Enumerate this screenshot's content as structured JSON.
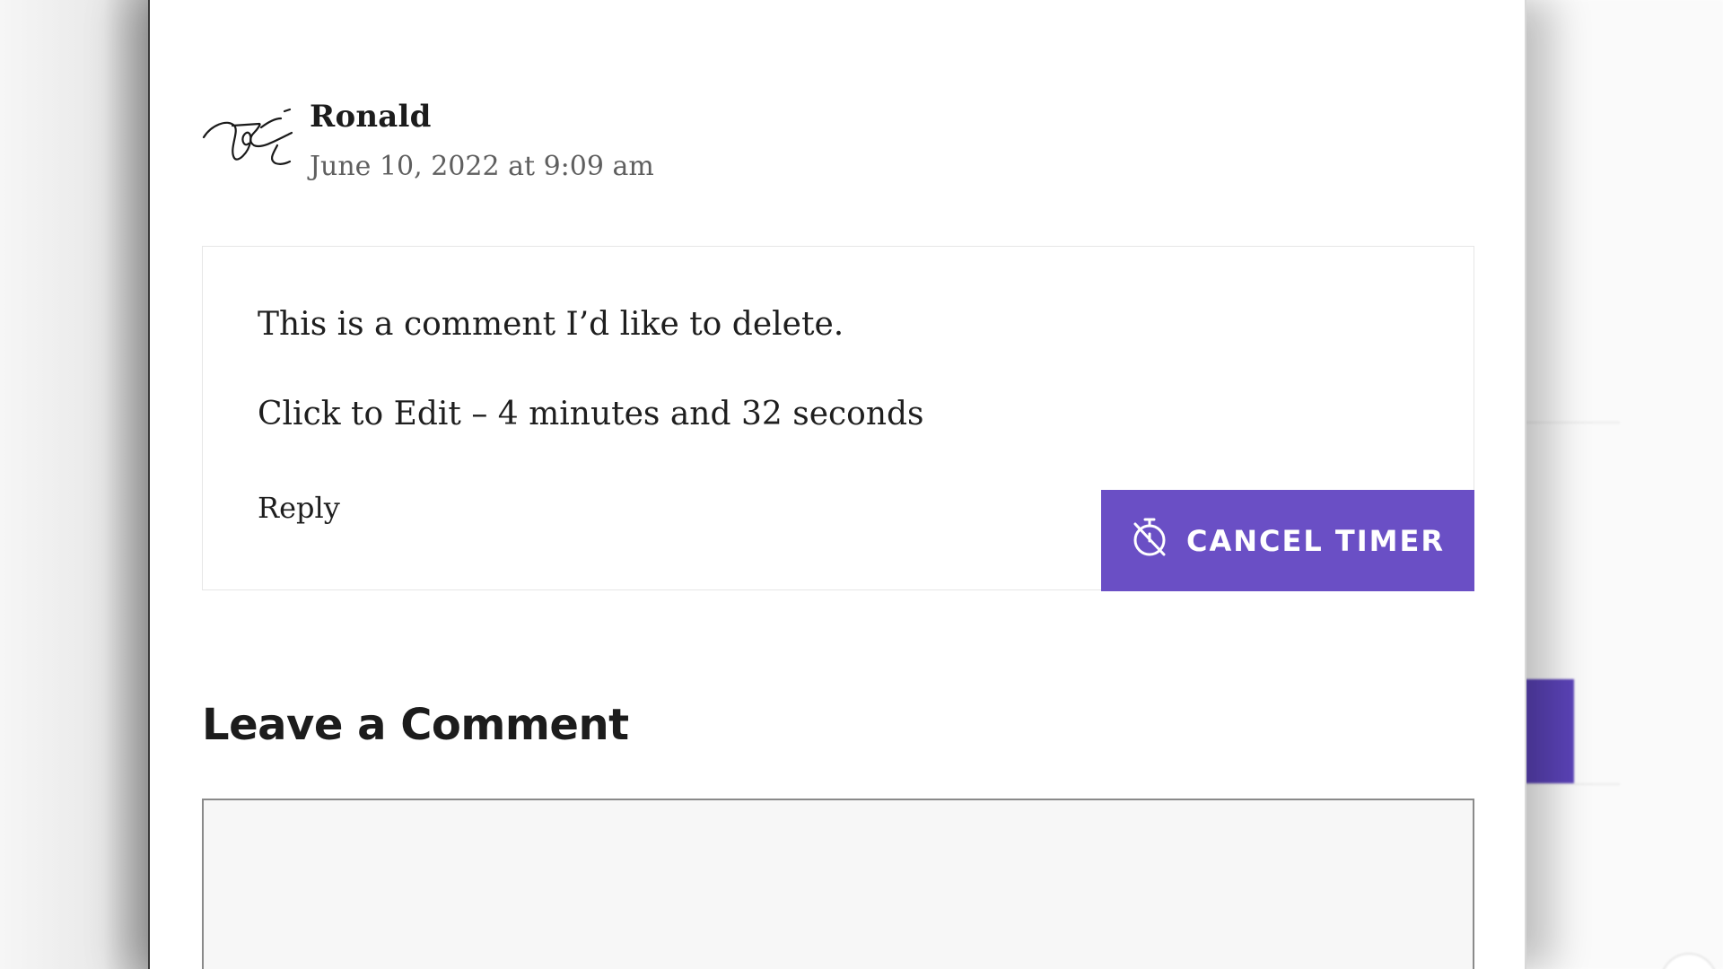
{
  "comment": {
    "author_name": "Ronald",
    "date": "June 10, 2022 at 9:09 am",
    "text": "This is a comment I’d like to delete.",
    "edit_line": "Click to Edit – 4 minutes and 32 seconds",
    "reply_label": "Reply",
    "cancel_timer_label": "CANCEL TIMER",
    "cancel_timer_icon": "timer-off-icon",
    "avatar_icon": "signature-avatar"
  },
  "leave_comment": {
    "heading": "Leave a Comment",
    "textarea_value": ""
  },
  "colors": {
    "accent": "#6a4fc5",
    "text": "#1e1e1e",
    "meta_text": "#5f5f5f",
    "field_bg": "#f7f7f7"
  }
}
